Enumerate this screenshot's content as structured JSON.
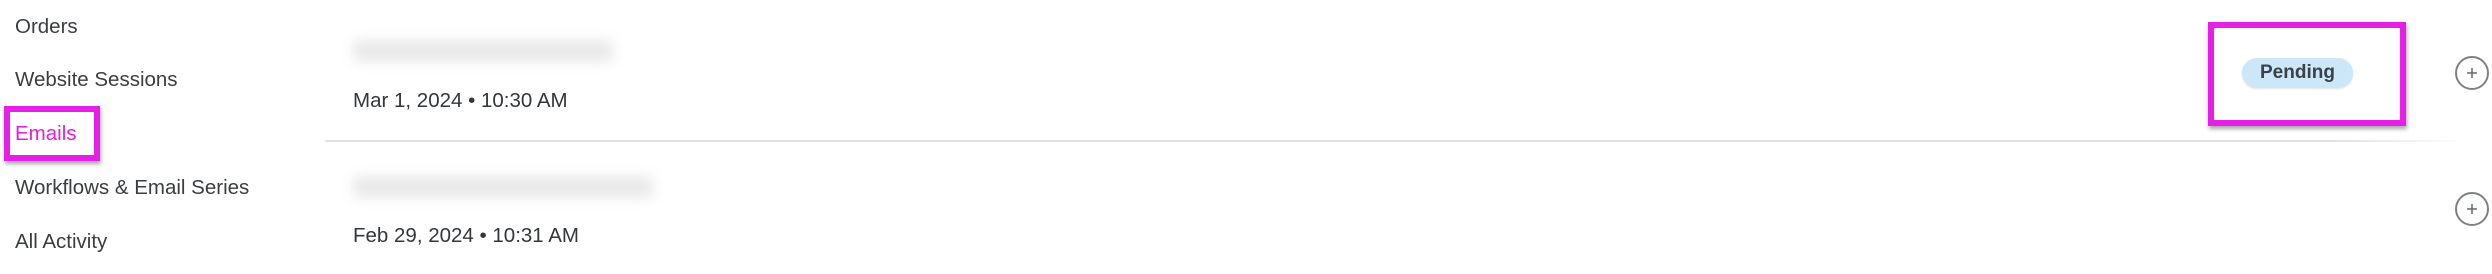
{
  "sidebar": {
    "items": [
      {
        "label": "Orders"
      },
      {
        "label": "Website Sessions"
      },
      {
        "label": "Emails"
      },
      {
        "label": "Workflows & Email Series"
      },
      {
        "label": "All Activity"
      }
    ],
    "active_index": 2
  },
  "activity": {
    "rows": [
      {
        "date": "Mar 1, 2024 • 10:30 AM",
        "status": "Pending",
        "add_icon": "plus-circle-icon"
      },
      {
        "date": "Feb 29, 2024 • 10:31 AM",
        "add_icon": "plus-circle-icon"
      }
    ]
  },
  "colors": {
    "active_nav": "#e41ce4",
    "highlight_border": "#e61ee6",
    "badge_bg": "#cce8f8",
    "text": "#33363a"
  }
}
